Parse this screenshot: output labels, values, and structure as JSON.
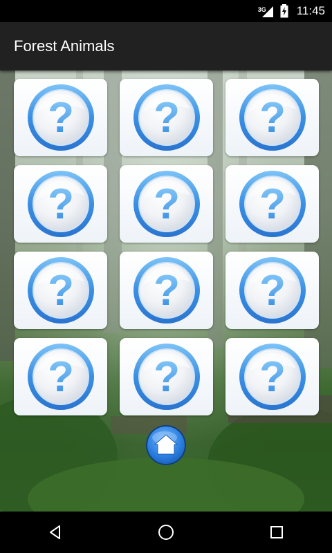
{
  "status_bar": {
    "network": "3G",
    "time": "11:45",
    "icons": [
      "signal-icon",
      "battery-charging-icon"
    ]
  },
  "app_bar": {
    "title": "Forest Animals"
  },
  "game": {
    "card_symbol": "?",
    "card_state": "face-down",
    "cards": [
      {
        "row": 1,
        "col": 1
      },
      {
        "row": 1,
        "col": 2
      },
      {
        "row": 1,
        "col": 3
      },
      {
        "row": 2,
        "col": 1
      },
      {
        "row": 2,
        "col": 2
      },
      {
        "row": 2,
        "col": 3
      },
      {
        "row": 3,
        "col": 1
      },
      {
        "row": 3,
        "col": 2
      },
      {
        "row": 3,
        "col": 3
      },
      {
        "row": 4,
        "col": 1
      },
      {
        "row": 4,
        "col": 2
      },
      {
        "row": 4,
        "col": 3
      }
    ],
    "home_icon": "home-icon"
  },
  "nav_bar": {
    "icons": [
      "back-icon",
      "home-circle-icon",
      "recents-icon"
    ]
  },
  "colors": {
    "app_bar": "#212121",
    "card_ring": "#3b8fe0",
    "question_mark": "#4aa6ee",
    "home_button": "#2c7fe0"
  }
}
